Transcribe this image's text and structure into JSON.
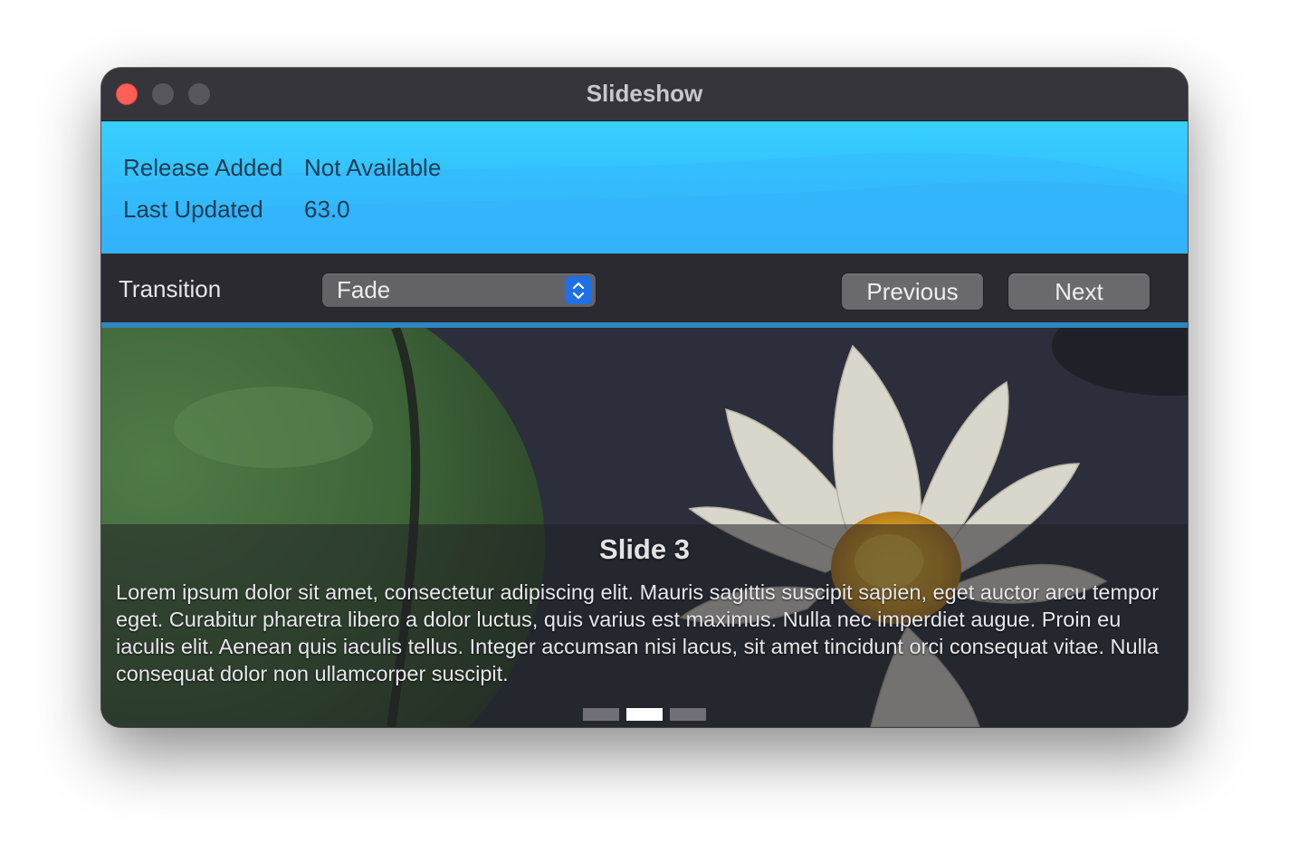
{
  "window": {
    "title": "Slideshow"
  },
  "info": {
    "rows": [
      {
        "label": "Release Added",
        "value": "Not Available"
      },
      {
        "label": "Last Updated",
        "value": "63.0"
      }
    ]
  },
  "controls": {
    "transition_label": "Transition",
    "transition_value": "Fade",
    "previous_label": "Previous",
    "next_label": "Next"
  },
  "slide": {
    "title": "Slide 3",
    "text": "Lorem ipsum dolor sit amet, consectetur adipiscing elit. Mauris sagittis suscipit sapien, eget auctor arcu tempor eget. Curabitur pharetra libero a dolor luctus, quis varius est maximus. Nulla nec imperdiet augue. Proin eu iaculis elit. Aenean quis iaculis tellus. Integer accumsan nisi lacus, sit amet tincidunt orci consequat vitae. Nulla consequat dolor non ullamcorper suscipit.",
    "indicator_count": 3,
    "active_index": 2
  },
  "colors": {
    "close_button": "#fe5f57",
    "info_background": "#36c6ff",
    "separator": "#2e86c1",
    "stepper_accent": "#1f6fe5"
  }
}
